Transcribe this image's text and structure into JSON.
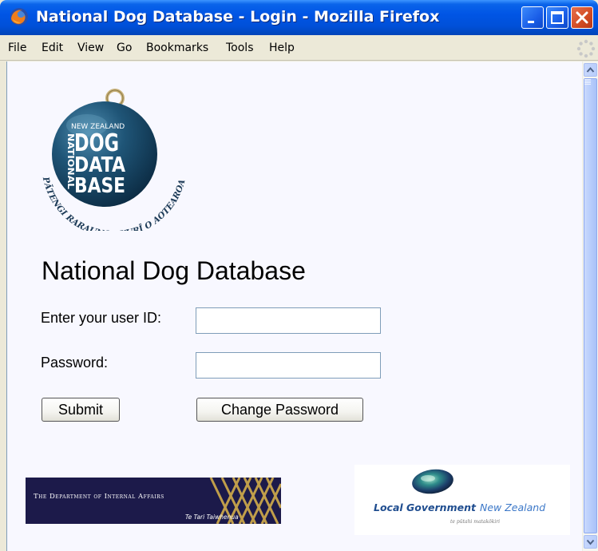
{
  "window": {
    "title": "National Dog Database - Login - Mozilla Firefox",
    "icon": "firefox-icon",
    "controls": [
      "minimize-icon",
      "maximize-icon",
      "close-icon"
    ]
  },
  "menubar": {
    "items": [
      "File",
      "Edit",
      "View",
      "Go",
      "Bookmarks",
      "Tools",
      "Help"
    ]
  },
  "page": {
    "logo": {
      "line1": "NEW ZEALAND",
      "line2": "DOG",
      "line3": "DATA",
      "line4": "BASE",
      "side_text": "NATIONAL",
      "arc_text": "PĀTENGI RARAUNGA KURĪ O AOTEAROA",
      "color": "#1d4a6b"
    },
    "heading": "National Dog Database",
    "form": {
      "user_label": "Enter your user ID:",
      "user_value": "",
      "password_label": "Password:",
      "password_value": "",
      "submit_label": "Submit",
      "change_password_label": "Change Password"
    },
    "dia_banner": {
      "line1": "The Department of Internal Affairs",
      "line2": "Te Tari Taiwhenua",
      "color": "#1c1a4a"
    },
    "lgnz_logo": {
      "name_bold": "Local Government",
      "name_italic": "New Zealand",
      "tagline": "te pūtahi matakōkiri",
      "color": "#1f4d8f"
    }
  },
  "colors": {
    "titlebar": "#0055e5",
    "menubar": "#ece9d8",
    "page_background": "#f8f8ff",
    "scrollbar_thumb": "#b5cbfb"
  }
}
